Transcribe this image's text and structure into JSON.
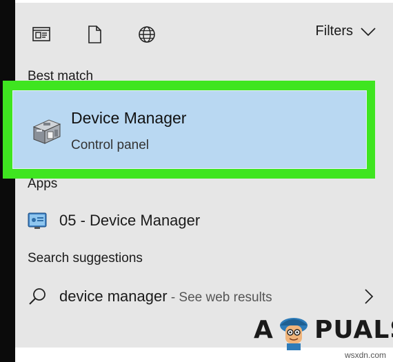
{
  "topbar": {
    "icons": [
      "document-app-icon",
      "file-icon",
      "globe-icon"
    ],
    "filters_label": "Filters"
  },
  "sections": {
    "best_match": "Best match",
    "apps": "Apps",
    "search_suggestions": "Search suggestions"
  },
  "best_match": {
    "title": "Device Manager",
    "subtitle": "Control panel",
    "highlight_color": "#3fe520",
    "selected_bg": "#b9d8f2"
  },
  "apps": [
    {
      "prefix": "05 - ",
      "title": "Device Manager"
    }
  ],
  "suggestions": [
    {
      "query": "device manager",
      "suffix": " - See web results"
    }
  ],
  "watermark": {
    "left": "A",
    "right": "PUALS"
  },
  "credit": "wsxdn.com"
}
